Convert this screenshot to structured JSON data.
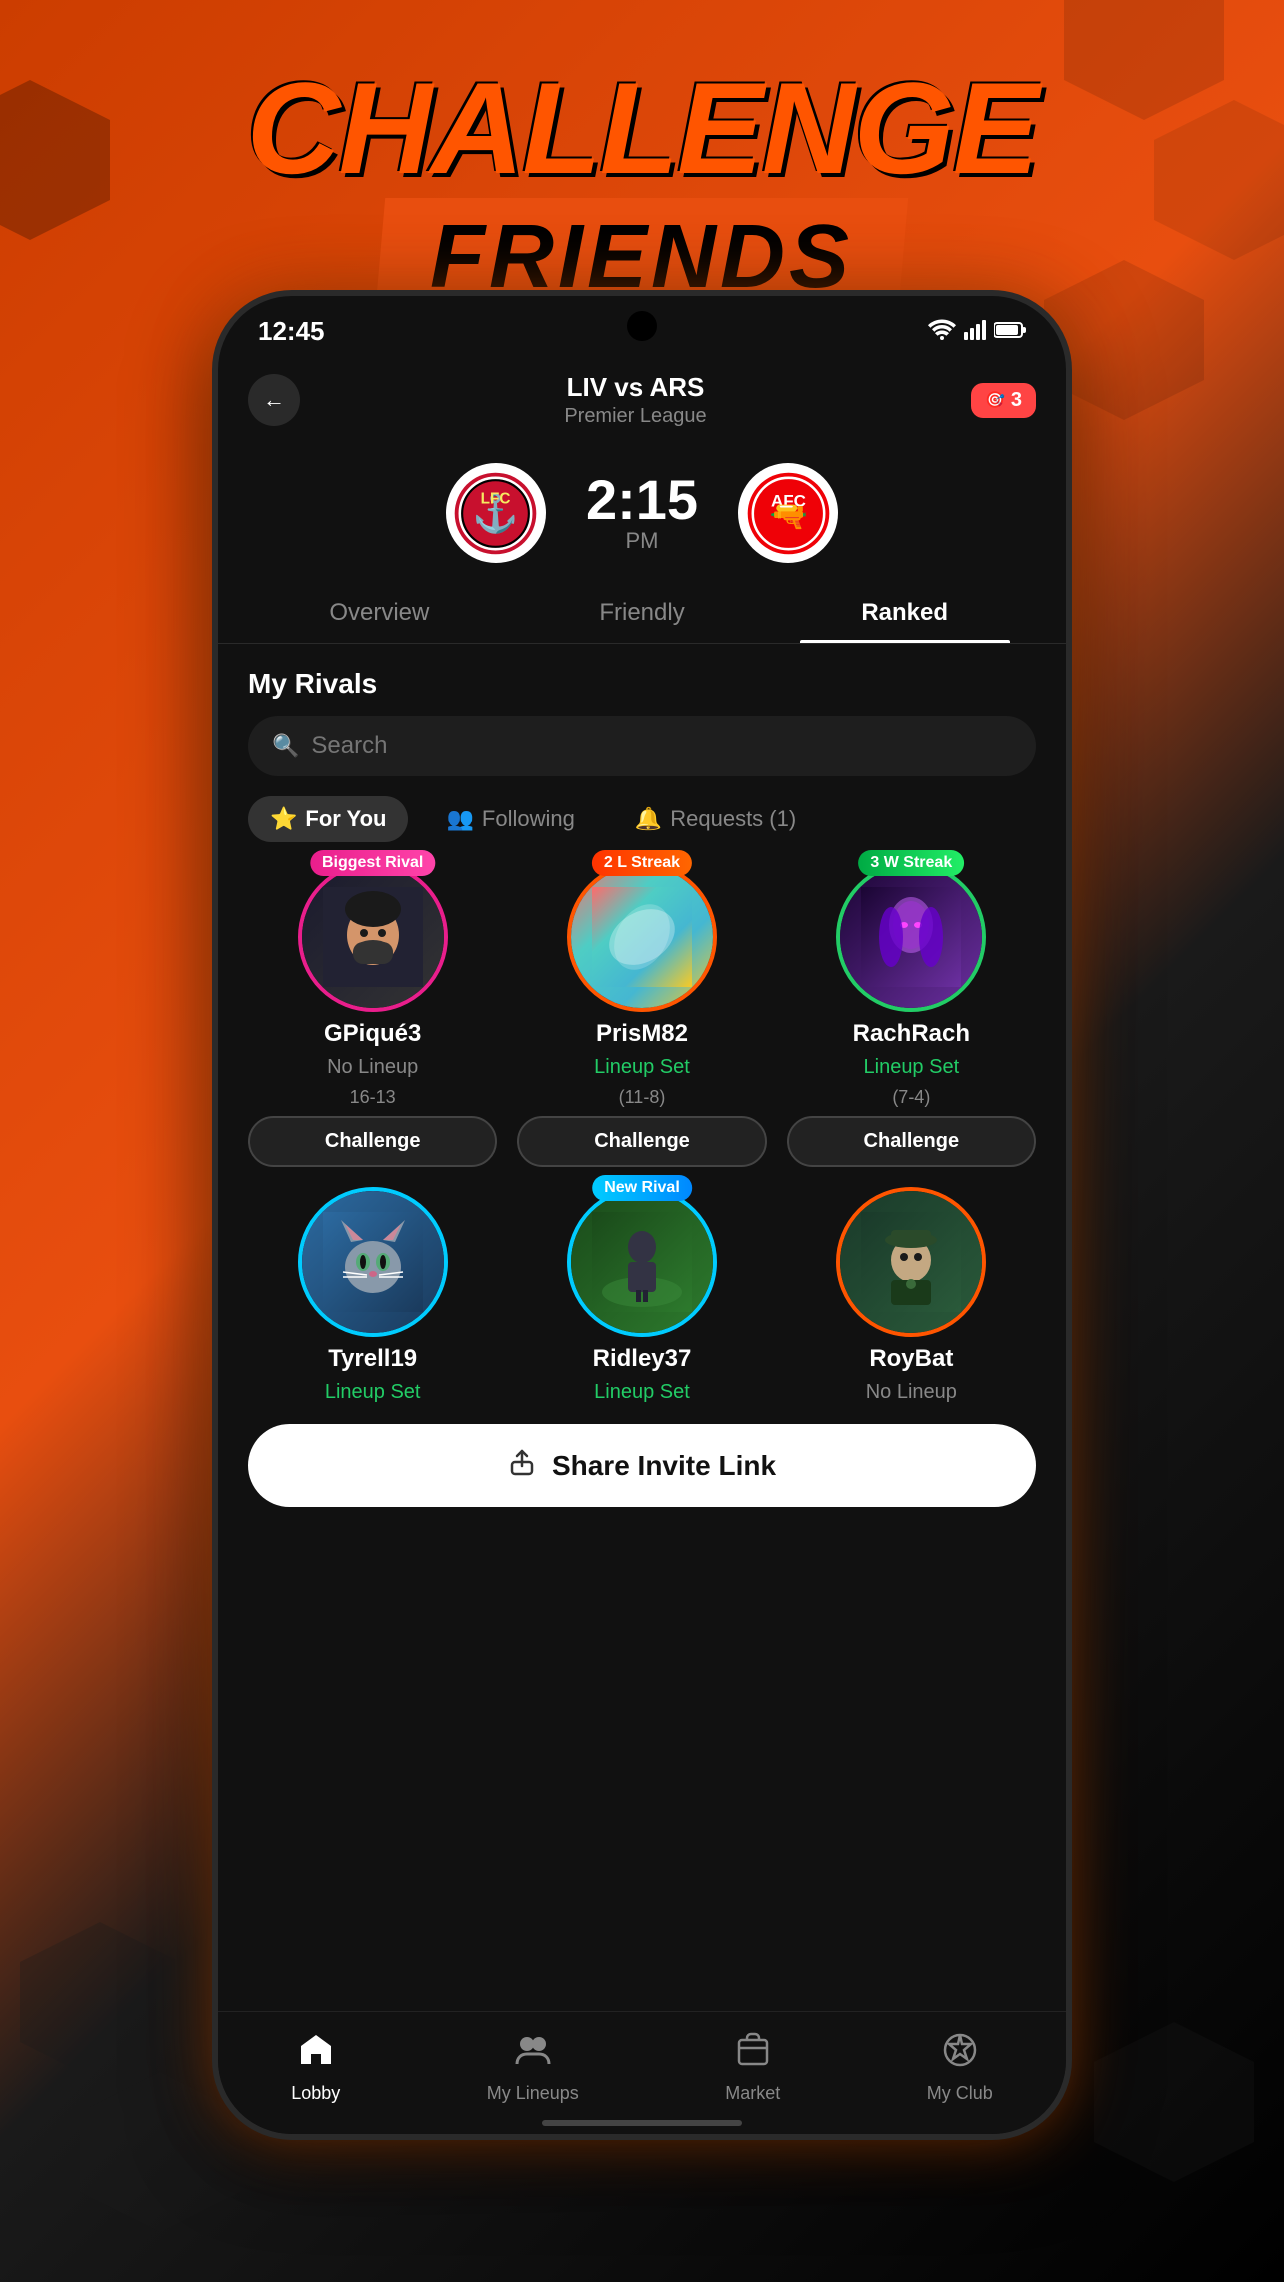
{
  "background": {
    "color_primary": "#e84e0f",
    "color_secondary": "#000000"
  },
  "banner": {
    "challenge_text": "CHALLENGE",
    "friends_text": "FRIENDS"
  },
  "status_bar": {
    "time": "12:45",
    "wifi": "wifi",
    "signal": "signal",
    "battery": "battery"
  },
  "header": {
    "back_label": "←",
    "match_title": "LIV vs ARS",
    "match_subtitle": "Premier League",
    "notification_count": "3"
  },
  "match": {
    "time": "2:15",
    "ampm": "PM",
    "home_team": "Liverpool",
    "away_team": "Arsenal"
  },
  "tabs": [
    {
      "label": "Overview",
      "active": false
    },
    {
      "label": "Friendly",
      "active": false
    },
    {
      "label": "Ranked",
      "active": true
    }
  ],
  "rivals_section": {
    "title": "My Rivals",
    "search_placeholder": "Search"
  },
  "filter_tabs": [
    {
      "label": "For You",
      "active": true,
      "icon": "⭐"
    },
    {
      "label": "Following",
      "active": false,
      "icon": "👥"
    },
    {
      "label": "Requests (1)",
      "active": false,
      "icon": "🔔"
    }
  ],
  "rivals_row1": [
    {
      "name": "GPiqué3",
      "badge": "Biggest Rival",
      "badge_type": "biggest-rival",
      "status": "No Lineup",
      "status_type": "no-lineup",
      "record": "16-13",
      "avatar_style": "av-gpique",
      "ring": "pink-ring",
      "avatar_emoji": "🧔"
    },
    {
      "name": "PrisM82",
      "badge": "2 L Streak",
      "badge_type": "l-streak",
      "status": "Lineup Set",
      "status_type": "set",
      "record": "(11-8)",
      "avatar_style": "av-prism",
      "ring": "orange-ring",
      "avatar_emoji": "🌈"
    },
    {
      "name": "RachRach",
      "badge": "3 W Streak",
      "badge_type": "w-streak",
      "status": "Lineup Set",
      "status_type": "set",
      "record": "(7-4)",
      "avatar_style": "av-rach",
      "ring": "green-ring",
      "avatar_emoji": "💃"
    }
  ],
  "rivals_row2": [
    {
      "name": "Tyrell19",
      "badge": null,
      "badge_type": null,
      "status": "Lineup Set",
      "status_type": "set",
      "record": "",
      "avatar_style": "av-tyrell",
      "ring": "cyan-ring",
      "avatar_emoji": "🐱"
    },
    {
      "name": "Ridley37",
      "badge": "New Rival",
      "badge_type": "new-rival",
      "status": "Lineup Set",
      "status_type": "set",
      "record": "",
      "avatar_style": "av-ridley",
      "ring": "cyan-ring",
      "avatar_emoji": "⚽"
    },
    {
      "name": "RoyBat",
      "badge": null,
      "badge_type": null,
      "status": "No Lineup",
      "status_type": "no-lineup",
      "record": "",
      "avatar_style": "av-roybat",
      "ring": "orange-ring",
      "avatar_emoji": "🦇"
    }
  ],
  "share_invite": {
    "label": "Share Invite Link",
    "icon": "⬆"
  },
  "bottom_nav": [
    {
      "label": "Lobby",
      "icon": "🏠",
      "active": true
    },
    {
      "label": "My Lineups",
      "icon": "👥",
      "active": false
    },
    {
      "label": "Market",
      "icon": "🃏",
      "active": false
    },
    {
      "label": "My Club",
      "icon": "⚽",
      "active": false
    }
  ],
  "challenge_button_label": "Challenge"
}
